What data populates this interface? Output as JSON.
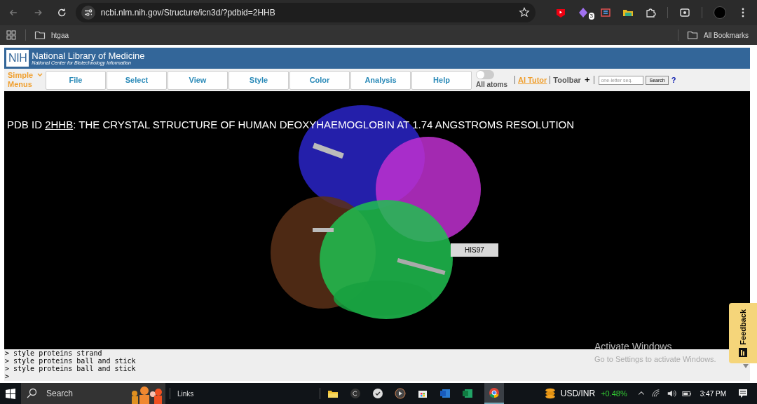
{
  "browser": {
    "url": "ncbi.nlm.nih.gov/Structure/icn3d/?pdbid=2HHB",
    "extension_badge": "3",
    "bookmarks": [
      "htgaa"
    ],
    "all_bookmarks": "All Bookmarks"
  },
  "header": {
    "logo": "NIH",
    "title": "National Library of Medicine",
    "subtitle": "National Center for Biotechnology Information"
  },
  "menubar": {
    "simple_menus": "Simple Menus",
    "menus": [
      "File",
      "Select",
      "View",
      "Style",
      "Color",
      "Analysis",
      "Help"
    ],
    "toggle": {
      "label": "All atoms",
      "on": false
    },
    "ai_tutor": "AI Tutor",
    "toolbar": "Toolbar",
    "toolbar_plus": "+",
    "search": {
      "placeholder": "one-letter seq."
    },
    "search_button": "Search",
    "help": "?"
  },
  "viewer": {
    "title_prefix": "PDB ID ",
    "pdb_link": "2HHB",
    "title_rest": ": THE CRYSTAL STRUCTURE OF HUMAN DEOXYHAEMOGLOBIN AT 1.74 ANGSTROMS RESOLUTION",
    "residue_label": "HIS97"
  },
  "console": {
    "lines": [
      "> style proteins strand",
      "> style proteins ball and stick",
      "> style proteins ball and stick"
    ],
    "prompt": ">"
  },
  "feedback": "Feedback",
  "watermark": {
    "title": "Activate Windows",
    "text": "Go to Settings to activate Windows."
  },
  "taskbar": {
    "search": "Search",
    "links": "Links",
    "ticker": "USD/INR",
    "change": "+0.48%",
    "time": "3:47 PM"
  }
}
